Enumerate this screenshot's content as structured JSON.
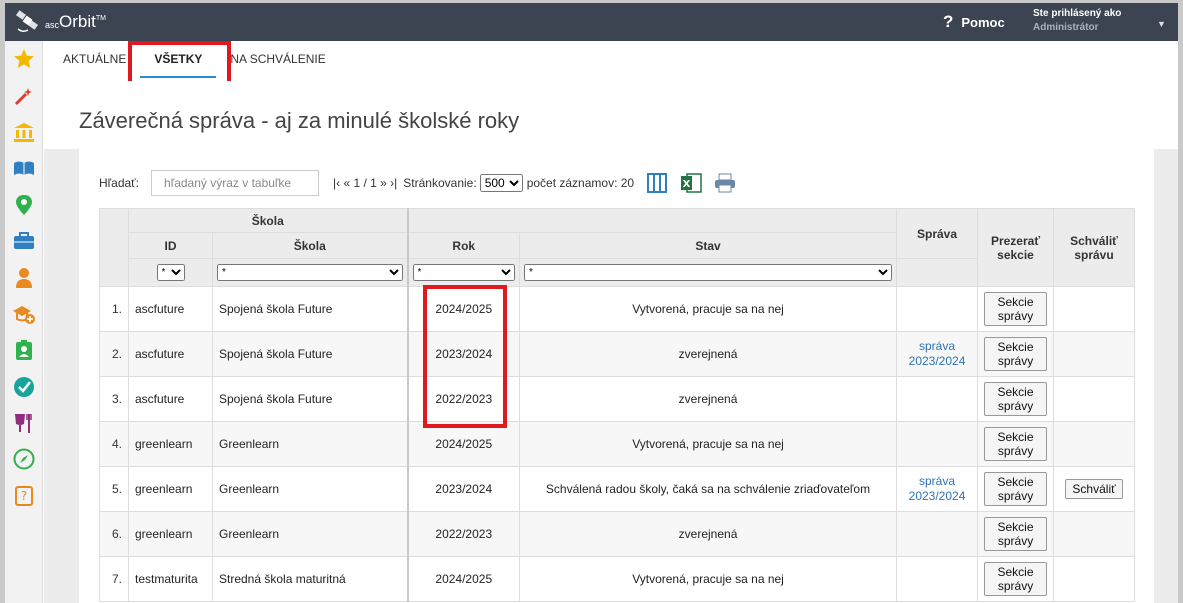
{
  "app": {
    "logo_text": "Orbit",
    "logo_prefix": "asc",
    "logo_tm": "TM",
    "help_label": "Pomoc",
    "help_icon": "?",
    "user_line1": "Ste prihlásený ako",
    "user_line2": "Administrátor"
  },
  "sidebar": {
    "items": [
      {
        "icon": "star-icon",
        "color": "#f5b800"
      },
      {
        "icon": "magic-wand-icon",
        "color": "#e23b2e"
      },
      {
        "icon": "building-icon",
        "color": "#f5b800"
      },
      {
        "icon": "book-icon",
        "color": "#2f7fc1"
      },
      {
        "icon": "map-pin-icon",
        "color": "#2fb24d"
      },
      {
        "icon": "briefcase-icon",
        "color": "#2f7fc1"
      },
      {
        "icon": "person-icon",
        "color": "#e98a20"
      },
      {
        "icon": "school-add-icon",
        "color": "#e98a20"
      },
      {
        "icon": "id-badge-icon",
        "color": "#2fb24d"
      },
      {
        "icon": "check-circle-icon",
        "color": "#1aa39a"
      },
      {
        "icon": "cup-fork-icon",
        "color": "#8e2e7d"
      },
      {
        "icon": "compass-icon",
        "color": "#2fb24d"
      },
      {
        "icon": "question-book-icon",
        "color": "#e98a20"
      }
    ]
  },
  "tabs": [
    {
      "label": "AKTUÁLNE",
      "active": false
    },
    {
      "label": "VŠETKY",
      "active": true
    },
    {
      "label": "NA SCHVÁLENIE",
      "active": false
    }
  ],
  "page_title": "Záverečná správa - aj za minulé školské roky",
  "toolbar": {
    "search_label": "Hľadať:",
    "search_placeholder": "hľadaný výraz v tabuľke",
    "pager": "|‹ « 1 / 1 » ›|",
    "paging_label": "Stránkovanie:",
    "paging_value": "500",
    "count_label": "počet záznamov: 20"
  },
  "table": {
    "group_header": "Škola",
    "headers": {
      "id": "ID",
      "school": "Škola",
      "year": "Rok",
      "status": "Stav",
      "report": "Správa",
      "view_sections": "Prezerať sekcie",
      "approve_report": "Schváliť správu"
    },
    "filters": {
      "id": "*",
      "school": "*",
      "year": "*",
      "status": "*"
    },
    "rows": [
      {
        "n": "1.",
        "id": "ascfuture",
        "school": "Spojená škola Future",
        "year": "2024/2025",
        "status": "Vytvorená, pracuje sa na nej",
        "report": "",
        "sections": "Sekcie správy",
        "approve": ""
      },
      {
        "n": "2.",
        "id": "ascfuture",
        "school": "Spojená škola Future",
        "year": "2023/2024",
        "status": "zverejnená",
        "report": "správa 2023/2024",
        "sections": "Sekcie správy",
        "approve": ""
      },
      {
        "n": "3.",
        "id": "ascfuture",
        "school": "Spojená škola Future",
        "year": "2022/2023",
        "status": "zverejnená",
        "report": "",
        "sections": "Sekcie správy",
        "approve": ""
      },
      {
        "n": "4.",
        "id": "greenlearn",
        "school": "Greenlearn",
        "year": "2024/2025",
        "status": "Vytvorená, pracuje sa na nej",
        "report": "",
        "sections": "Sekcie správy",
        "approve": ""
      },
      {
        "n": "5.",
        "id": "greenlearn",
        "school": "Greenlearn",
        "year": "2023/2024",
        "status": "Schválená radou školy, čaká sa na schválenie zriaďovateľom",
        "report": "správa 2023/2024",
        "sections": "Sekcie správy",
        "approve": "Schváliť"
      },
      {
        "n": "6.",
        "id": "greenlearn",
        "school": "Greenlearn",
        "year": "2022/2023",
        "status": "zverejnená",
        "report": "",
        "sections": "Sekcie správy",
        "approve": ""
      },
      {
        "n": "7.",
        "id": "testmaturita",
        "school": "Stredná škola maturitná",
        "year": "2024/2025",
        "status": "Vytvorená, pracuje sa na nej",
        "report": "",
        "sections": "Sekcie správy",
        "approve": ""
      }
    ]
  },
  "colors": {
    "topbar": "#3b4450",
    "accent": "#2b8bd0",
    "highlight": "#e0181f",
    "link": "#2f73b0"
  }
}
